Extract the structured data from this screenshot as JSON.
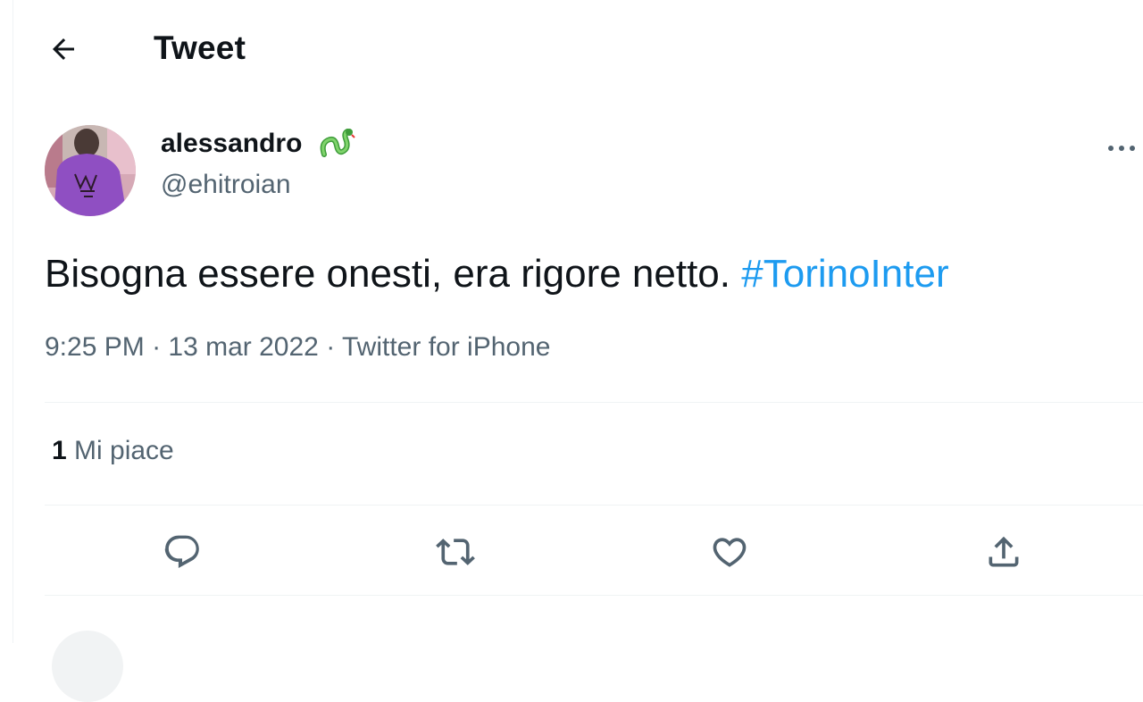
{
  "header": {
    "title": "Tweet",
    "back_icon": "arrow-left-icon"
  },
  "tweet": {
    "author": {
      "display_name": "alessandro",
      "badge_icon": "green-snake-emoji-icon",
      "handle": "@ehitroian",
      "avatar": "purple-hoodie-photo"
    },
    "text": "Bisogna essere onesti, era rigore netto.",
    "hashtag": "#TorinoInter",
    "time": "9:25 PM",
    "separator": "·",
    "date": "13 mar 2022",
    "source": "Twitter for iPhone",
    "likes_count": "1",
    "likes_label": "Mi piace"
  },
  "actions": {
    "reply_icon": "reply-icon",
    "retweet_icon": "retweet-icon",
    "like_icon": "heart-icon",
    "share_icon": "share-icon"
  },
  "colors": {
    "link": "#1d9bf0",
    "secondary_text": "#536471",
    "primary_text": "#0f1419",
    "divider": "#eff3f4",
    "badge_green": "#4caf50"
  }
}
